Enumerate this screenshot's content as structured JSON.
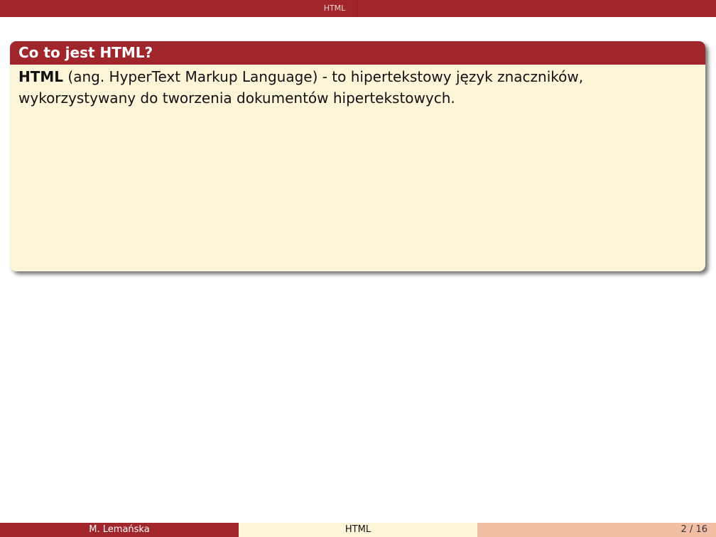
{
  "header": {
    "section_title": "HTML"
  },
  "block": {
    "title": "Co to jest HTML?",
    "term": "HTML",
    "definition_line1": " (ang. HyperText Markup Language) - to hipertekstowy język znaczników,",
    "definition_line2": "wykorzystywany do tworzenia dokumentów hipertekstowych."
  },
  "footer": {
    "author": "M. Lemańska",
    "title": "HTML",
    "page": "2 / 16"
  },
  "colors": {
    "theme_red": "#a0262b",
    "block_body": "#fdf5d8",
    "footer_right": "#f2bfa5"
  }
}
